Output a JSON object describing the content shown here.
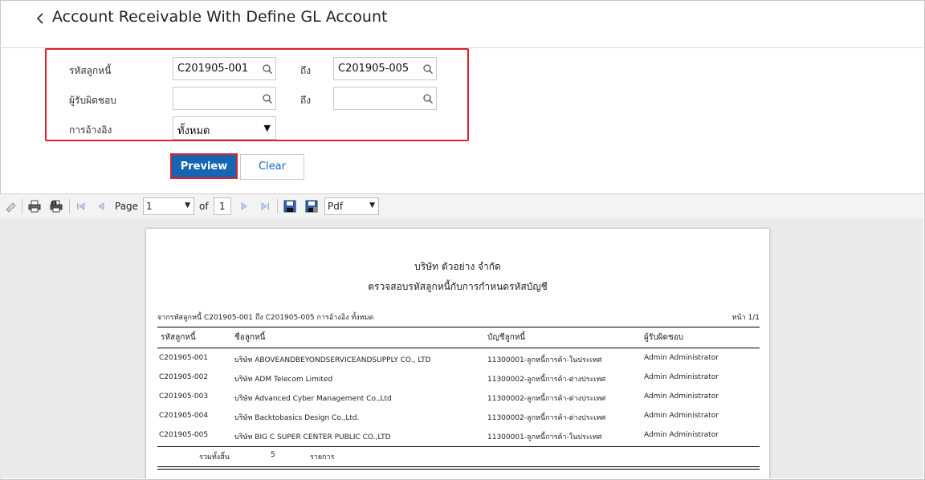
{
  "header": {
    "title": "Account Receivable With Define GL Account"
  },
  "filters": {
    "debtor_code_label": "รหัสลูกหนี้",
    "debtor_code_from": "C201905-001",
    "to_label_1": "ถึง",
    "debtor_code_to": "C201905-005",
    "responsible_label": "ผู้รับผิดชอบ",
    "responsible_from": "",
    "to_label_2": "ถึง",
    "responsible_to": "",
    "reference_label": "การอ้างอิง",
    "reference_value": "ทั้งหมด"
  },
  "buttons": {
    "preview": "Preview",
    "clear": "Clear"
  },
  "toolbar": {
    "page_label": "Page",
    "page_value": "1",
    "of_label": "of",
    "total_pages": "1",
    "export_format": "Pdf"
  },
  "report": {
    "company": "บริษัท ตัวอย่าง จำกัด",
    "title": "ตรวจสอบรหัสลูกหนี้กับการกำหนดรหัสบัญชี",
    "criteria": "จากรหัสลูกหนี้ C201905-001 ถึง C201905-005 การอ้างอิง ทั้งหมด",
    "page_no": "หน้า 1/1",
    "columns": [
      "รหัสลูกหนี้",
      "ชื่อลูกหนี้",
      "บัญชีลูกหนี้",
      "ผู้รับผิดชอบ"
    ],
    "rows": [
      {
        "code": "C201905-001",
        "name": "บริษัท ABOVEANDBEYONDSERVICEANDSUPPLY CO., LTD",
        "account": "11300001-ลูกหนี้การค้า-ในประเทศ",
        "owner": "Admin Administrator"
      },
      {
        "code": "C201905-002",
        "name": "บริษัท ADM Telecom Limited",
        "account": "11300002-ลูกหนี้การค้า-ต่างประเทศ",
        "owner": "Admin Administrator"
      },
      {
        "code": "C201905-003",
        "name": "บริษัท Advanced Cyber Management Co.,Ltd",
        "account": "11300002-ลูกหนี้การค้า-ต่างประเทศ",
        "owner": "Admin Administrator"
      },
      {
        "code": "C201905-004",
        "name": "บริษัท Backtobasics Design Co.,Ltd.",
        "account": "11300002-ลูกหนี้การค้า-ต่างประเทศ",
        "owner": "Admin Administrator"
      },
      {
        "code": "C201905-005",
        "name": "บริษัท BIG C SUPER CENTER PUBLIC CO.,LTD",
        "account": "11300001-ลูกหนี้การค้า-ในประเทศ",
        "owner": "Admin Administrator"
      }
    ],
    "total_label": "รวมทั้งสิ้น",
    "total_count": "5",
    "total_unit": "รายการ"
  },
  "colors": {
    "accent": "#1466b3",
    "highlight": "#e0202a"
  },
  "icons": [
    "chevron-left-icon",
    "search-icon",
    "dropdown-arrow-icon",
    "print-icon",
    "first-page-icon",
    "previous-page-icon",
    "next-page-icon",
    "last-page-icon",
    "save-icon"
  ]
}
